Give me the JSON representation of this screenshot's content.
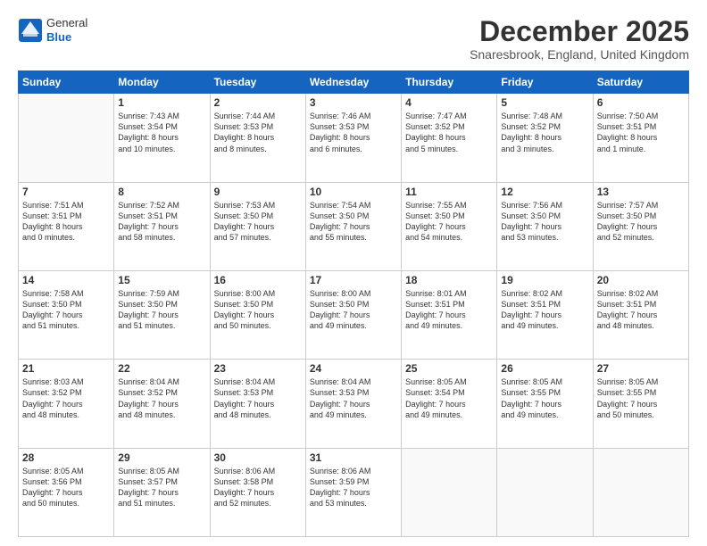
{
  "logo": {
    "general": "General",
    "blue": "Blue"
  },
  "title": "December 2025",
  "subtitle": "Snaresbrook, England, United Kingdom",
  "headers": [
    "Sunday",
    "Monday",
    "Tuesday",
    "Wednesday",
    "Thursday",
    "Friday",
    "Saturday"
  ],
  "weeks": [
    [
      {
        "day": "",
        "lines": []
      },
      {
        "day": "1",
        "lines": [
          "Sunrise: 7:43 AM",
          "Sunset: 3:54 PM",
          "Daylight: 8 hours",
          "and 10 minutes."
        ]
      },
      {
        "day": "2",
        "lines": [
          "Sunrise: 7:44 AM",
          "Sunset: 3:53 PM",
          "Daylight: 8 hours",
          "and 8 minutes."
        ]
      },
      {
        "day": "3",
        "lines": [
          "Sunrise: 7:46 AM",
          "Sunset: 3:53 PM",
          "Daylight: 8 hours",
          "and 6 minutes."
        ]
      },
      {
        "day": "4",
        "lines": [
          "Sunrise: 7:47 AM",
          "Sunset: 3:52 PM",
          "Daylight: 8 hours",
          "and 5 minutes."
        ]
      },
      {
        "day": "5",
        "lines": [
          "Sunrise: 7:48 AM",
          "Sunset: 3:52 PM",
          "Daylight: 8 hours",
          "and 3 minutes."
        ]
      },
      {
        "day": "6",
        "lines": [
          "Sunrise: 7:50 AM",
          "Sunset: 3:51 PM",
          "Daylight: 8 hours",
          "and 1 minute."
        ]
      }
    ],
    [
      {
        "day": "7",
        "lines": [
          "Sunrise: 7:51 AM",
          "Sunset: 3:51 PM",
          "Daylight: 8 hours",
          "and 0 minutes."
        ]
      },
      {
        "day": "8",
        "lines": [
          "Sunrise: 7:52 AM",
          "Sunset: 3:51 PM",
          "Daylight: 7 hours",
          "and 58 minutes."
        ]
      },
      {
        "day": "9",
        "lines": [
          "Sunrise: 7:53 AM",
          "Sunset: 3:50 PM",
          "Daylight: 7 hours",
          "and 57 minutes."
        ]
      },
      {
        "day": "10",
        "lines": [
          "Sunrise: 7:54 AM",
          "Sunset: 3:50 PM",
          "Daylight: 7 hours",
          "and 55 minutes."
        ]
      },
      {
        "day": "11",
        "lines": [
          "Sunrise: 7:55 AM",
          "Sunset: 3:50 PM",
          "Daylight: 7 hours",
          "and 54 minutes."
        ]
      },
      {
        "day": "12",
        "lines": [
          "Sunrise: 7:56 AM",
          "Sunset: 3:50 PM",
          "Daylight: 7 hours",
          "and 53 minutes."
        ]
      },
      {
        "day": "13",
        "lines": [
          "Sunrise: 7:57 AM",
          "Sunset: 3:50 PM",
          "Daylight: 7 hours",
          "and 52 minutes."
        ]
      }
    ],
    [
      {
        "day": "14",
        "lines": [
          "Sunrise: 7:58 AM",
          "Sunset: 3:50 PM",
          "Daylight: 7 hours",
          "and 51 minutes."
        ]
      },
      {
        "day": "15",
        "lines": [
          "Sunrise: 7:59 AM",
          "Sunset: 3:50 PM",
          "Daylight: 7 hours",
          "and 51 minutes."
        ]
      },
      {
        "day": "16",
        "lines": [
          "Sunrise: 8:00 AM",
          "Sunset: 3:50 PM",
          "Daylight: 7 hours",
          "and 50 minutes."
        ]
      },
      {
        "day": "17",
        "lines": [
          "Sunrise: 8:00 AM",
          "Sunset: 3:50 PM",
          "Daylight: 7 hours",
          "and 49 minutes."
        ]
      },
      {
        "day": "18",
        "lines": [
          "Sunrise: 8:01 AM",
          "Sunset: 3:51 PM",
          "Daylight: 7 hours",
          "and 49 minutes."
        ]
      },
      {
        "day": "19",
        "lines": [
          "Sunrise: 8:02 AM",
          "Sunset: 3:51 PM",
          "Daylight: 7 hours",
          "and 49 minutes."
        ]
      },
      {
        "day": "20",
        "lines": [
          "Sunrise: 8:02 AM",
          "Sunset: 3:51 PM",
          "Daylight: 7 hours",
          "and 48 minutes."
        ]
      }
    ],
    [
      {
        "day": "21",
        "lines": [
          "Sunrise: 8:03 AM",
          "Sunset: 3:52 PM",
          "Daylight: 7 hours",
          "and 48 minutes."
        ]
      },
      {
        "day": "22",
        "lines": [
          "Sunrise: 8:04 AM",
          "Sunset: 3:52 PM",
          "Daylight: 7 hours",
          "and 48 minutes."
        ]
      },
      {
        "day": "23",
        "lines": [
          "Sunrise: 8:04 AM",
          "Sunset: 3:53 PM",
          "Daylight: 7 hours",
          "and 48 minutes."
        ]
      },
      {
        "day": "24",
        "lines": [
          "Sunrise: 8:04 AM",
          "Sunset: 3:53 PM",
          "Daylight: 7 hours",
          "and 49 minutes."
        ]
      },
      {
        "day": "25",
        "lines": [
          "Sunrise: 8:05 AM",
          "Sunset: 3:54 PM",
          "Daylight: 7 hours",
          "and 49 minutes."
        ]
      },
      {
        "day": "26",
        "lines": [
          "Sunrise: 8:05 AM",
          "Sunset: 3:55 PM",
          "Daylight: 7 hours",
          "and 49 minutes."
        ]
      },
      {
        "day": "27",
        "lines": [
          "Sunrise: 8:05 AM",
          "Sunset: 3:55 PM",
          "Daylight: 7 hours",
          "and 50 minutes."
        ]
      }
    ],
    [
      {
        "day": "28",
        "lines": [
          "Sunrise: 8:05 AM",
          "Sunset: 3:56 PM",
          "Daylight: 7 hours",
          "and 50 minutes."
        ]
      },
      {
        "day": "29",
        "lines": [
          "Sunrise: 8:05 AM",
          "Sunset: 3:57 PM",
          "Daylight: 7 hours",
          "and 51 minutes."
        ]
      },
      {
        "day": "30",
        "lines": [
          "Sunrise: 8:06 AM",
          "Sunset: 3:58 PM",
          "Daylight: 7 hours",
          "and 52 minutes."
        ]
      },
      {
        "day": "31",
        "lines": [
          "Sunrise: 8:06 AM",
          "Sunset: 3:59 PM",
          "Daylight: 7 hours",
          "and 53 minutes."
        ]
      },
      {
        "day": "",
        "lines": []
      },
      {
        "day": "",
        "lines": []
      },
      {
        "day": "",
        "lines": []
      }
    ]
  ]
}
